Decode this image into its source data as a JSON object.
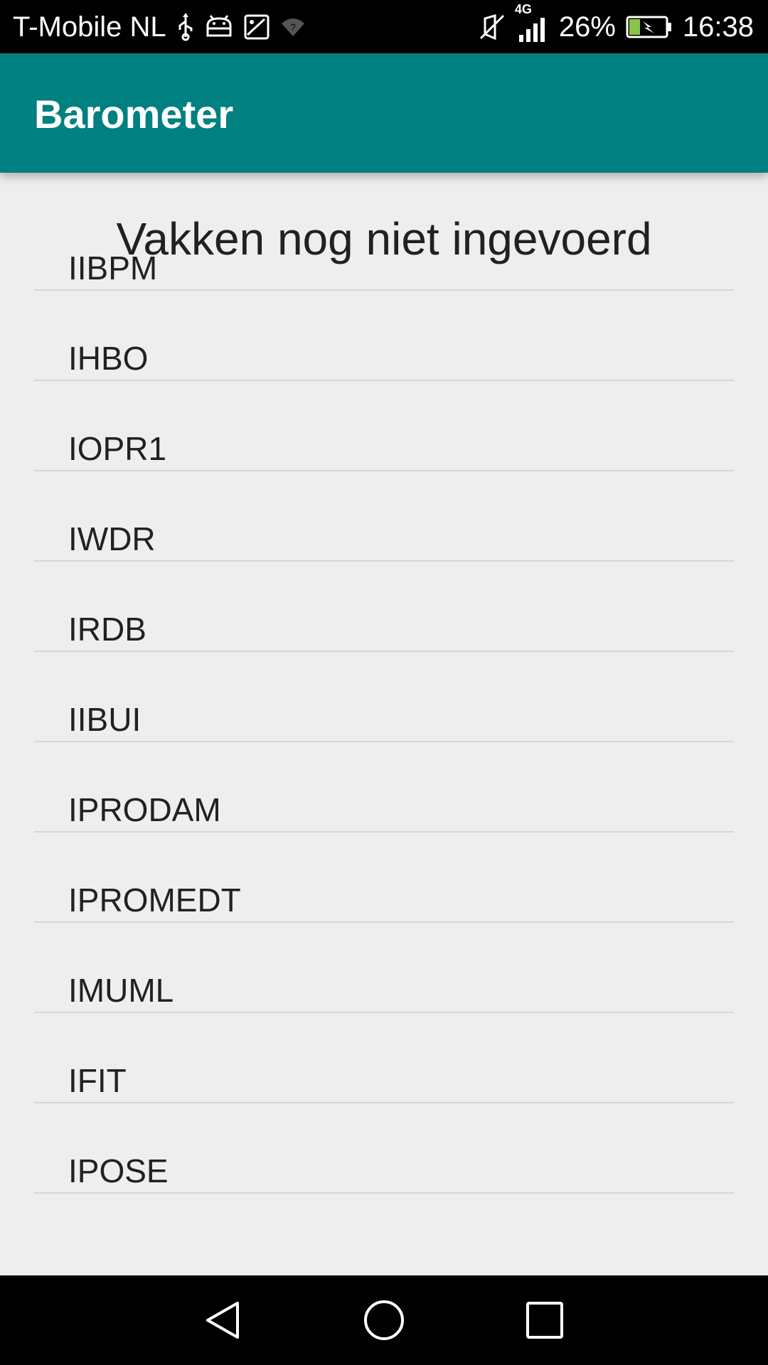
{
  "status_bar": {
    "carrier": "T-Mobile  NL",
    "network_type": "4G",
    "battery": "26%",
    "time": "16:38",
    "icons": [
      "usb-icon",
      "android-debug-icon",
      "image-notification-icon",
      "wifi-unknown-icon",
      "mute-icon",
      "signal-icon",
      "battery-charging-icon"
    ]
  },
  "app_bar": {
    "title": "Barometer",
    "color": "#008080"
  },
  "main": {
    "heading": "Vakken nog niet ingevoerd",
    "courses": [
      "IIBPM",
      "IHBO",
      "IOPR1",
      "IWDR",
      "IRDB",
      "IIBUI",
      "IPRODAM",
      "IPROMEDT",
      "IMUML",
      "IFIT",
      "IPOSE"
    ]
  },
  "nav_bar": {
    "icons": [
      "back-icon",
      "home-icon",
      "recents-icon"
    ]
  }
}
